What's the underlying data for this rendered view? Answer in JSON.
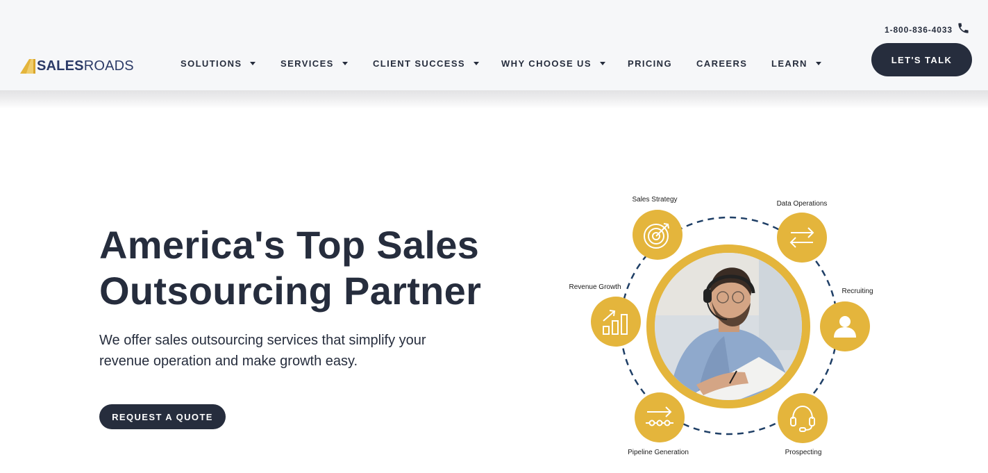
{
  "header": {
    "logo": {
      "part1": "SALES",
      "part2": "ROADS"
    },
    "nav": [
      {
        "label": "SOLUTIONS",
        "dropdown": true
      },
      {
        "label": "SERVICES",
        "dropdown": true
      },
      {
        "label": "CLIENT SUCCESS",
        "dropdown": true
      },
      {
        "label": "WHY CHOOSE US",
        "dropdown": true
      },
      {
        "label": "PRICING",
        "dropdown": false
      },
      {
        "label": "CAREERS",
        "dropdown": false
      },
      {
        "label": "LEARN",
        "dropdown": true
      }
    ],
    "phone": "1-800-836-4033",
    "cta_label": "LET'S TALK"
  },
  "hero": {
    "title_line1": "America's Top Sales",
    "title_line2": "Outsourcing Partner",
    "subtitle_line1": "We offer sales outsourcing services that simplify your",
    "subtitle_line2": "revenue operation and make growth easy.",
    "cta_label": "REQUEST A QUOTE"
  },
  "diagram": {
    "nodes": [
      {
        "label": "Sales Strategy",
        "icon": "target-icon"
      },
      {
        "label": "Data Operations",
        "icon": "arrows-exchange-icon"
      },
      {
        "label": "Recruiting",
        "icon": "person-icon"
      },
      {
        "label": "Prospecting",
        "icon": "headset-icon"
      },
      {
        "label": "Pipeline Generation",
        "icon": "pipeline-icon"
      },
      {
        "label": "Revenue Growth",
        "icon": "bar-growth-icon"
      }
    ]
  },
  "colors": {
    "navy": "#262d3d",
    "gold": "#e4b53c",
    "logo_blue": "#2b3a67",
    "dashed_ring": "#1f3f66"
  }
}
